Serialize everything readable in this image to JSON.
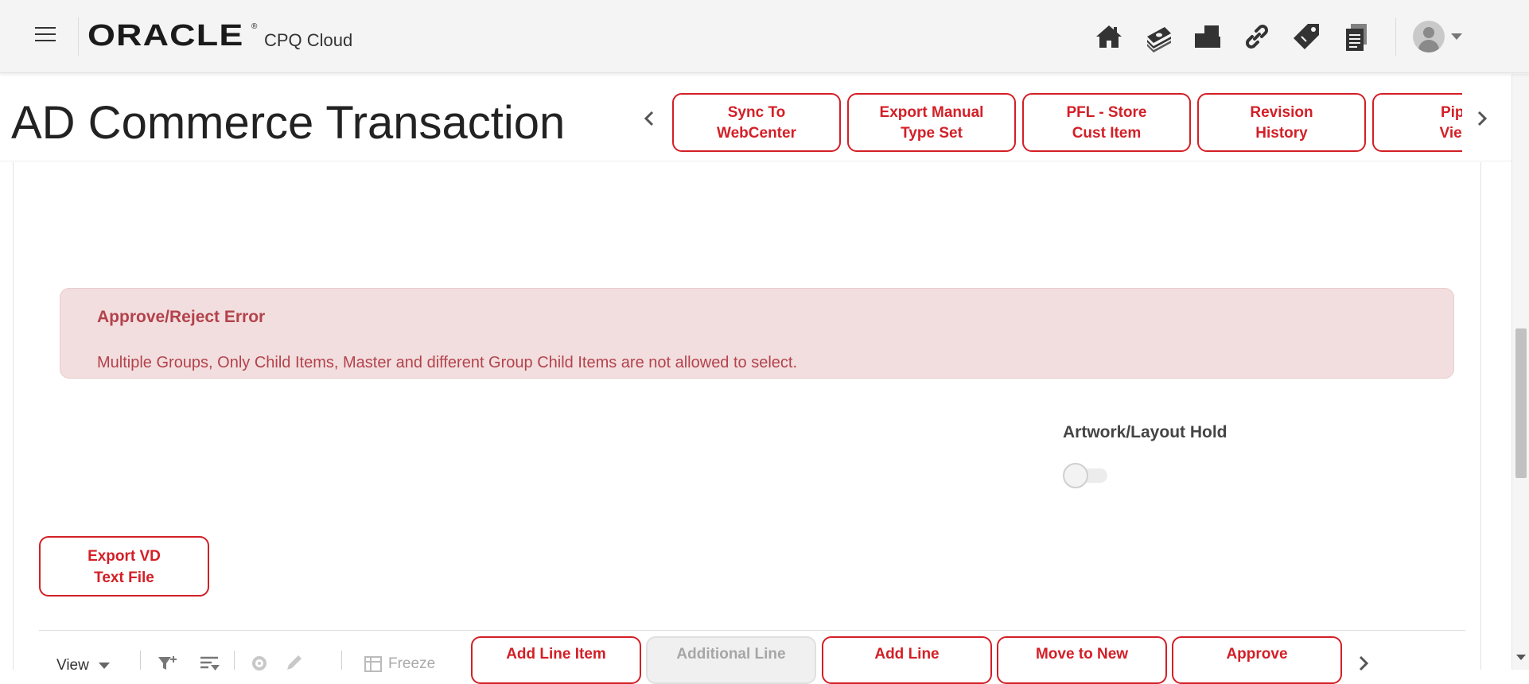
{
  "appbar": {
    "logo_text": "ORACLE",
    "logo_mark": "®",
    "product_name": "CPQ Cloud",
    "icons": [
      "home-icon",
      "money-icon",
      "folders-icon",
      "link-icon",
      "tag-icon",
      "documents-icon"
    ],
    "user_menu": {
      "avatar": "user-avatar-icon",
      "caret": "caret-down-icon"
    }
  },
  "header": {
    "title": "AD Commerce Transaction",
    "actions": [
      {
        "label": "Sync To\nWebCenter"
      },
      {
        "label": "Export Manual\nType Set"
      },
      {
        "label": "PFL - Store\nCust Item"
      },
      {
        "label": "Revision\nHistory"
      },
      {
        "label": "Pipe\nView"
      }
    ]
  },
  "error": {
    "title": "Approve/Reject Error",
    "message": "Multiple Groups, Only Child Items, Master and different Group Child Items are not allowed to select."
  },
  "artwork_hold": {
    "label": "Artwork/Layout Hold",
    "enabled": false
  },
  "export_vd": {
    "label": "Export VD\nText File"
  },
  "line_toolbar": {
    "view_label": "View",
    "freeze_label": "Freeze",
    "buttons": [
      {
        "label": "Add Line Item",
        "disabled": false
      },
      {
        "label": "Additional Line",
        "disabled": true
      },
      {
        "label": "Add Line",
        "disabled": false
      },
      {
        "label": "Move to New",
        "disabled": false
      },
      {
        "label": "Approve",
        "disabled": false
      }
    ]
  },
  "colors": {
    "accent": "#d31f26",
    "error_bg": "#f2dede",
    "error_text": "#b3424c"
  }
}
